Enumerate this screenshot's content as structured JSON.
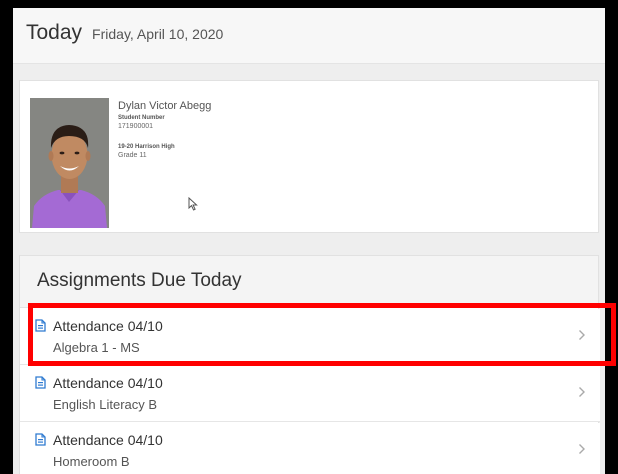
{
  "header": {
    "title": "Today",
    "date": "Friday, April 10, 2020"
  },
  "student": {
    "name": "Dylan Victor Abegg",
    "number_label": "Student Number",
    "number": "171900001",
    "school": "19-20 Harrison High",
    "grade": "Grade 11"
  },
  "assignments": {
    "title": "Assignments Due Today",
    "items": [
      {
        "title": "Attendance 04/10",
        "course": "Algebra 1 - MS"
      },
      {
        "title": "Attendance 04/10",
        "course": "English Literacy B"
      },
      {
        "title": "Attendance 04/10",
        "course": "Homeroom B"
      }
    ]
  },
  "icons": {
    "assignment": "document-icon",
    "row_arrow": "chevron-right-icon",
    "pointer": "mouse-cursor-icon"
  },
  "colors": {
    "highlight": "#ff0000",
    "doc_icon": "#2f7bd1"
  }
}
